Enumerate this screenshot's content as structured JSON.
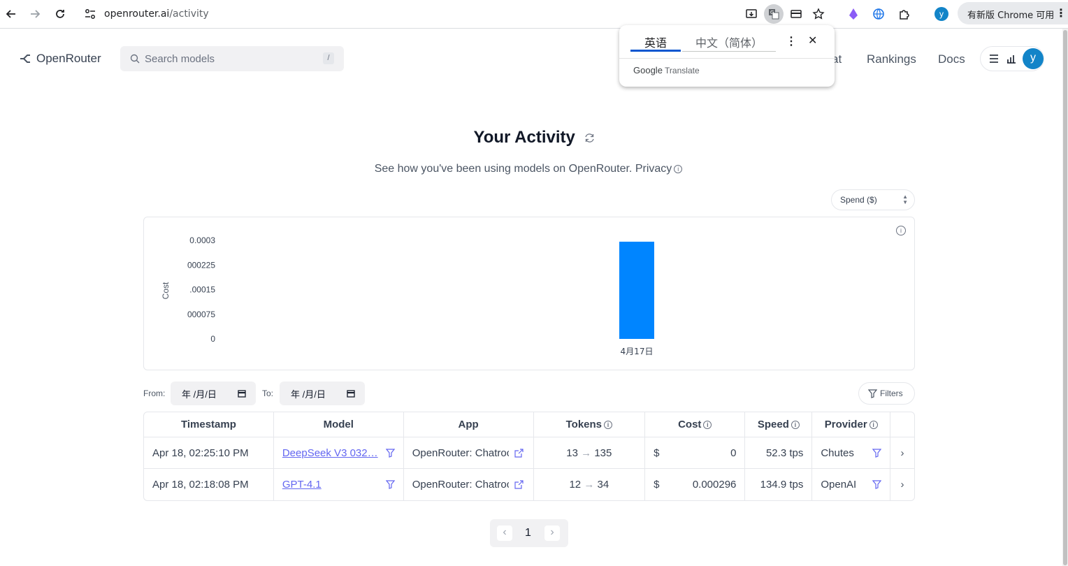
{
  "browser": {
    "url_host": "openrouter.ai",
    "url_path": "/activity",
    "update_label": "有新版 Chrome 可用",
    "profile_initial": "y"
  },
  "translate_popup": {
    "tab_source": "英语",
    "tab_target": "中文（简体）",
    "brand": "Google",
    "product": "Translate"
  },
  "header": {
    "logo": "OpenRouter",
    "search_placeholder": "Search models",
    "search_shortcut": "/",
    "nav_partial": "at",
    "nav_rankings": "Rankings",
    "nav_docs": "Docs",
    "avatar_initial": "y"
  },
  "page": {
    "title": "Your Activity",
    "subtitle": "See how you've been using models on OpenRouter.",
    "privacy_label": "Privacy",
    "metric_select": "Spend ($)"
  },
  "chart_data": {
    "type": "bar",
    "categories": [
      "4月17日"
    ],
    "values": [
      0.000296
    ],
    "ylabel": "Cost",
    "yticks": [
      "0.0003",
      "000225",
      ".00015",
      "000075",
      "0"
    ],
    "ylim": [
      0,
      0.0003
    ],
    "color": "#0085ff"
  },
  "filters": {
    "from_label": "From:",
    "from_value": "年 /月/日",
    "to_label": "To:",
    "to_value": "年 /月/日",
    "filters_button": "Filters"
  },
  "table": {
    "headers": {
      "timestamp": "Timestamp",
      "model": "Model",
      "app": "App",
      "tokens": "Tokens",
      "cost": "Cost",
      "speed": "Speed",
      "provider": "Provider"
    },
    "rows": [
      {
        "timestamp": "Apr 18, 02:25:10 PM",
        "model": "DeepSeek V3 032…",
        "app": "OpenRouter: Chatroc",
        "tokens_in": "13",
        "tokens_out": "135",
        "currency": "$",
        "cost": "0",
        "speed": "52.3 tps",
        "provider": "Chutes"
      },
      {
        "timestamp": "Apr 18, 02:18:08 PM",
        "model": "GPT-4.1",
        "app": "OpenRouter: Chatroc",
        "tokens_in": "12",
        "tokens_out": "34",
        "currency": "$",
        "cost": "0.000296",
        "speed": "134.9 tps",
        "provider": "OpenAI"
      }
    ]
  },
  "pagination": {
    "current_page": "1"
  }
}
